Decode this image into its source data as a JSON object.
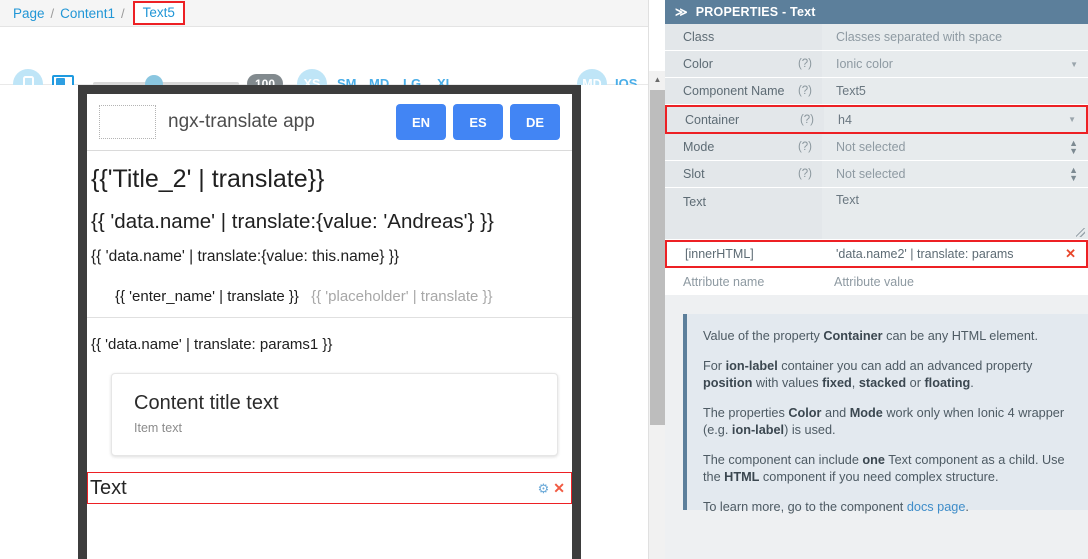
{
  "breadcrumb": {
    "items": [
      {
        "label": "Page",
        "selected": false
      },
      {
        "label": "Content1",
        "selected": false
      },
      {
        "label": "Text5",
        "selected": true
      }
    ],
    "separator": "/"
  },
  "toolbar": {
    "device_phone_icon": "phone-icon",
    "device_tablet_icon": "tablet-icon",
    "zoom_value": "100",
    "breakpoints": [
      {
        "label": "XS",
        "active": true
      },
      {
        "label": "SM",
        "active": false
      },
      {
        "label": "MD",
        "active": false
      },
      {
        "label": "LG",
        "active": false
      },
      {
        "label": "XL",
        "active": false
      }
    ],
    "mode_badge": "MD",
    "mode_platform": "IOS"
  },
  "preview": {
    "app_title": "ngx-translate app",
    "lang_buttons": [
      "EN",
      "ES",
      "DE"
    ],
    "lines": {
      "title2": "{{'Title_2' | translate}}",
      "name_andreas": "{{ 'data.name' | translate:{value: 'Andreas'} }}",
      "name_this": "{{ 'data.name' | translate:{value: this.name} }}",
      "input_label": "{{ 'enter_name' | translate }}",
      "input_placeholder": "{{ 'placeholder' | translate }}",
      "params1": "{{ 'data.name' | translate: params1 }}"
    },
    "card": {
      "title": "Content title text",
      "subtitle": "Item text"
    },
    "selected": {
      "label": "Text",
      "gear_icon": "gear-icon",
      "close_icon": "close-icon"
    }
  },
  "properties": {
    "header": "PROPERTIES - Text",
    "header_chevron": "≫",
    "rows": [
      {
        "key": "Class",
        "help": "",
        "value": "",
        "placeholder": "Classes separated with space",
        "control": "text"
      },
      {
        "key": "Color",
        "help": "(?)",
        "value": "",
        "placeholder": "Ionic color",
        "control": "select"
      },
      {
        "key": "Component Name",
        "help": "(?)",
        "value": "Text5",
        "placeholder": "",
        "control": "text"
      },
      {
        "key": "Container",
        "help": "(?)",
        "value": "h4",
        "placeholder": "",
        "control": "select",
        "highlighted": true
      },
      {
        "key": "Mode",
        "help": "(?)",
        "value": "Not selected",
        "placeholder": "",
        "control": "spinner"
      },
      {
        "key": "Slot",
        "help": "(?)",
        "value": "Not selected",
        "placeholder": "",
        "control": "spinner"
      },
      {
        "key": "Text",
        "help": "",
        "value": "Text",
        "placeholder": "",
        "control": "textarea"
      }
    ],
    "attributes": {
      "innerhtml_key": "[innerHTML]",
      "innerhtml_value": "'data.name2' | translate: params",
      "remove_icon": "✕",
      "new_name_placeholder": "Attribute name",
      "new_value_placeholder": "Attribute value"
    },
    "help": {
      "p1_a": "Value of the property ",
      "p1_b": "Container",
      "p1_c": " can be any HTML element.",
      "p2_a": "For ",
      "p2_b": "ion-label",
      "p2_c": " container you can add an advanced property ",
      "p2_d": "position",
      "p2_e": " with values ",
      "p2_f": "fixed",
      "p2_g": ", ",
      "p2_h": "stacked",
      "p2_i": " or ",
      "p2_j": "floating",
      "p2_k": ".",
      "p3_a": "The properties ",
      "p3_b": "Color",
      "p3_c": " and ",
      "p3_d": "Mode",
      "p3_e": " work only when Ionic 4 wrapper (e.g. ",
      "p3_f": "ion-label",
      "p3_g": ") is used.",
      "p4_a": "The component can include ",
      "p4_b": "one",
      "p4_c": " Text component as a child. Use the ",
      "p4_d": "HTML",
      "p4_e": " component if you need complex structure.",
      "p5_a": "To learn more, go to the component ",
      "p5_link": "docs page",
      "p5_b": "."
    }
  },
  "colors": {
    "accent_blue": "#4aaee8",
    "header_slate": "#5c7f9b",
    "highlight_red": "#ed2024",
    "button_blue": "#4285f4",
    "panel_bg": "#eef0f2"
  }
}
